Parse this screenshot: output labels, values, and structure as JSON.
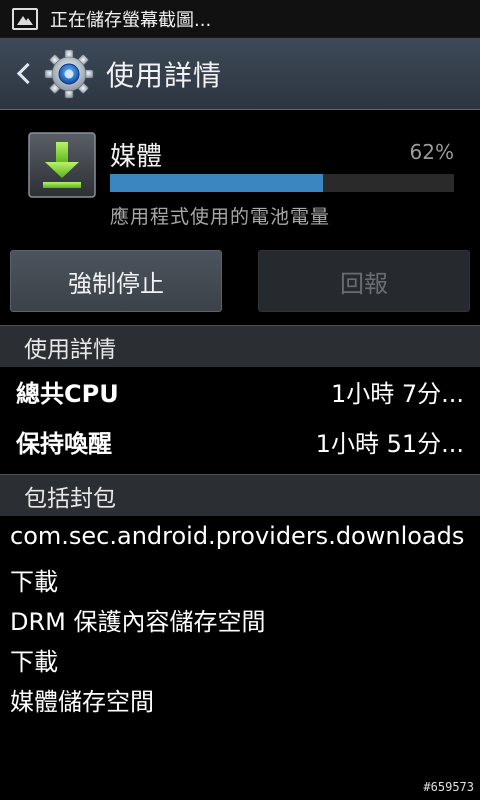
{
  "status_bar": {
    "icon": "image-icon",
    "text": "正在儲存螢幕截圖..."
  },
  "action_bar": {
    "back_icon": "chevron-left-icon",
    "app_icon": "settings-gear-icon",
    "title": "使用詳情"
  },
  "app": {
    "icon": "download-icon",
    "name": "媒體",
    "percent_label": "62%",
    "percent_value": 62,
    "subtitle": "應用程式使用的電池電量"
  },
  "buttons": {
    "force_stop": "強制停止",
    "report": "回報"
  },
  "usage_section": {
    "header": "使用詳情",
    "rows": [
      {
        "label": "總共CPU",
        "value": "1小時 7分..."
      },
      {
        "label": "保持喚醒",
        "value": "1小時 51分..."
      }
    ]
  },
  "packages_section": {
    "header": "包括封包",
    "items": [
      "com.sec.android.providers.downloads",
      "下載",
      "DRM 保護內容儲存空間",
      "下載",
      "媒體儲存空間"
    ]
  },
  "watermark": "#659573",
  "colors": {
    "progress_fill": "#3b86c0",
    "action_bar": "#3e4a58",
    "section_header": "#2b2f33"
  }
}
